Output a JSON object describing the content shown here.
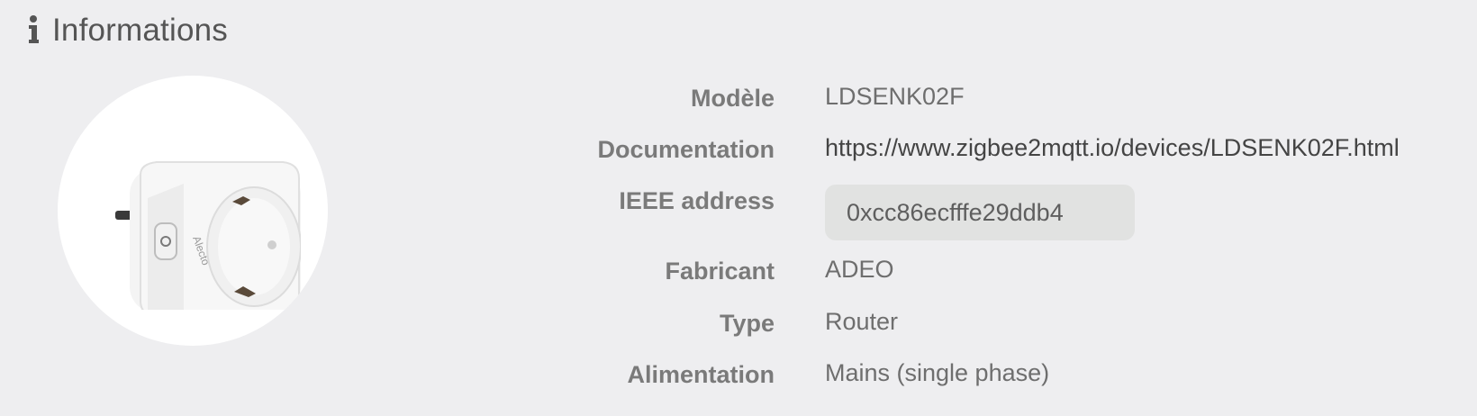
{
  "header": {
    "title": "Informations",
    "icon": "info-icon"
  },
  "device": {
    "image_icon": "smart-plug-icon",
    "brand_mark": "Alecto"
  },
  "details": [
    {
      "label": "Modèle",
      "value": "LDSENK02F"
    },
    {
      "label": "Documentation",
      "value": "https://www.zigbee2mqtt.io/devices/LDSENK02F.html"
    },
    {
      "label": "IEEE address",
      "value": "0xcc86ecfffe29ddb4"
    },
    {
      "label": "Fabricant",
      "value": "ADEO"
    },
    {
      "label": "Type",
      "value": "Router"
    },
    {
      "label": "Alimentation",
      "value": "Mains (single phase)"
    }
  ],
  "colors": {
    "background": "#eeeef0",
    "label": "#7a7a7a",
    "value": "#6e6e6e",
    "ieee_box": "#e1e2e1"
  }
}
